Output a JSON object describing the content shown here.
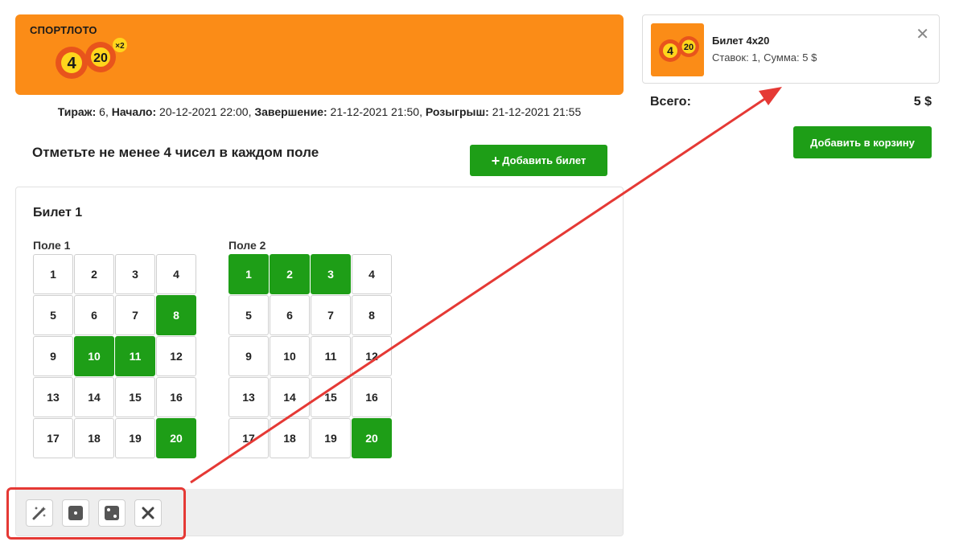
{
  "brand": {
    "name": "СПОРТЛОТО",
    "game_digit_left": "4",
    "game_digit_right": "20",
    "multiplier": "×2"
  },
  "draw_info": {
    "draw_label": "Тираж:",
    "draw_value": "6,",
    "start_label": "Начало:",
    "start_value": "20-12-2021 22:00,",
    "end_label": "Завершение:",
    "end_value": "21-12-2021 21:50,",
    "raffle_label": "Розыгрыш:",
    "raffle_value": "21-12-2021 21:55"
  },
  "instruction": "Отметьте не менее 4 чисел в каждом поле",
  "add_ticket_label": "Добавить билет",
  "ticket": {
    "title": "Билет 1",
    "fields": [
      {
        "label": "Поле 1",
        "numbers": [
          "1",
          "2",
          "3",
          "4",
          "5",
          "6",
          "7",
          "8",
          "9",
          "10",
          "11",
          "12",
          "13",
          "14",
          "15",
          "16",
          "17",
          "18",
          "19",
          "20"
        ],
        "selected": [
          8,
          10,
          11,
          20
        ]
      },
      {
        "label": "Поле 2",
        "numbers": [
          "1",
          "2",
          "3",
          "4",
          "5",
          "6",
          "7",
          "8",
          "9",
          "10",
          "11",
          "12",
          "13",
          "14",
          "15",
          "16",
          "17",
          "18",
          "19",
          "20"
        ],
        "selected": [
          1,
          2,
          3,
          20
        ]
      }
    ],
    "tools": [
      "magic-wand-icon",
      "dice-one-icon",
      "dice-two-icon",
      "close-icon"
    ]
  },
  "cart": {
    "item_name": "Билет 4х20",
    "bets_label": "Ставок: 1,",
    "sum_label": "Сумма: 5 $",
    "total_label": "Всего:",
    "total_value": "5 $",
    "add_to_cart_label": "Добавить в корзину"
  },
  "colors": {
    "brand_orange": "#fb8c17",
    "selected_green": "#1e9e17",
    "annotation_red": "#e53935"
  }
}
